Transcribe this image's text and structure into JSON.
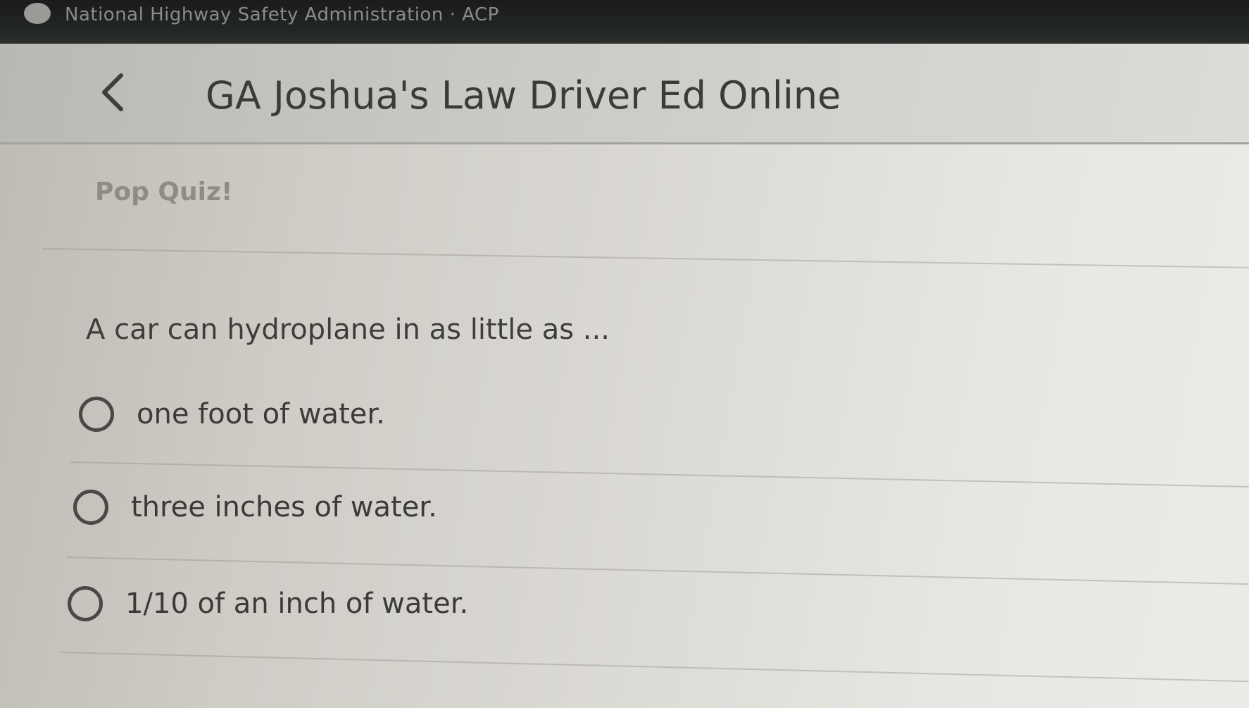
{
  "status_bar": {
    "text": "National Highway Safety Administration · ACP"
  },
  "header": {
    "back_icon": "chevron-left-icon",
    "title": "GA Joshua's Law Driver Ed Online"
  },
  "quiz": {
    "heading": "Pop Quiz!",
    "question": "A car can hydroplane in as little as ...",
    "options": [
      {
        "label": "one foot of water."
      },
      {
        "label": "three inches of water."
      },
      {
        "label": "1/10 of an inch of water."
      }
    ]
  },
  "colors": {
    "status_bar_bg": "#1f2221",
    "header_bg": "#c9c9c6",
    "text": "#3b3b39"
  }
}
